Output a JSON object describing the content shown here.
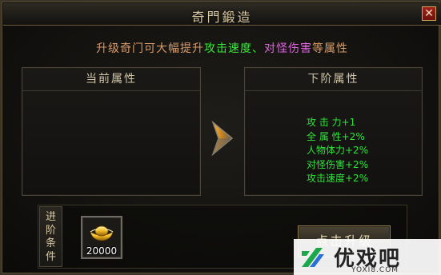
{
  "window": {
    "title": "奇門鍛造",
    "close_symbol": "✕"
  },
  "subtitle": {
    "part1": "升级奇门可大幅提升",
    "part2": "攻击速度、",
    "part3": "对怪伤害",
    "part4": "等属性"
  },
  "current_panel": {
    "title": "当前属性",
    "attributes": []
  },
  "next_panel": {
    "title": "下阶属性",
    "attributes": [
      "攻 击 力+1",
      "全 属 性+2%",
      "人物体力+2%",
      "对怪伤害+2%",
      "攻击速度+2%"
    ]
  },
  "conditions": {
    "label_chars": [
      "进",
      "阶",
      "条",
      "件"
    ],
    "item_icon": "gold-ingot-icon",
    "item_count": "20000"
  },
  "upgrade_button": {
    "label": "点击升级"
  },
  "watermark": {
    "name": "优戏吧",
    "url": "YOXI8.COM"
  },
  "colors": {
    "attribute_green": "#2fe33a",
    "highlight_green": "#39e83a",
    "highlight_magenta": "#e066e0",
    "subtitle_orange": "#d99b6a",
    "close_red": "#a3221a",
    "watermark_accent": "#1aa84a"
  }
}
